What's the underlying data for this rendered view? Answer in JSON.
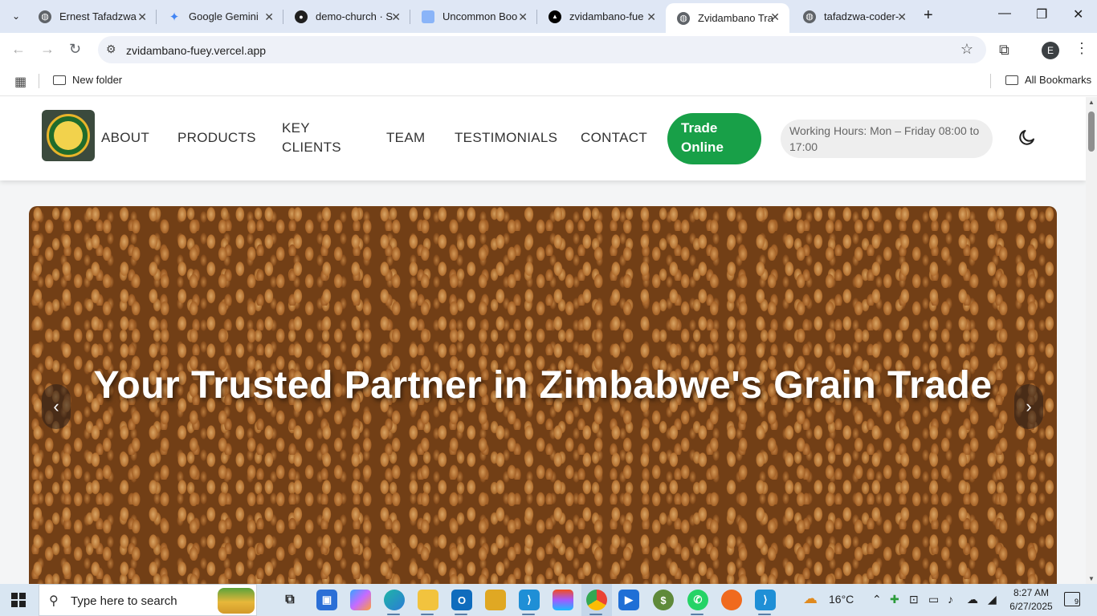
{
  "browser": {
    "tabs": [
      {
        "label": "Ernest Tafadzwa",
        "icon": "globe-icon",
        "color": "#5f6368"
      },
      {
        "label": "Google Gemini",
        "icon": "gemini-icon",
        "color": "#4285f4"
      },
      {
        "label": "demo-church · S",
        "icon": "github-icon",
        "color": "#1f1f1f"
      },
      {
        "label": "Uncommon Boo",
        "icon": "sheets-icon",
        "color": "#8ab4f8"
      },
      {
        "label": "zvidambano-fue",
        "icon": "vercel-icon",
        "color": "#000000"
      },
      {
        "label": "Zvidambano Tra",
        "icon": "globe-icon",
        "color": "#5f6368",
        "active": true
      },
      {
        "label": "tafadzwa-coder-",
        "icon": "globe-icon",
        "color": "#5f6368"
      }
    ],
    "url": "zvidambano-fuey.vercel.app",
    "profile_initial": "E",
    "bookmarks": {
      "folder": "New folder",
      "all": "All Bookmarks"
    }
  },
  "site": {
    "logo_alt": "Zvidambano Traders Pvt Ltd",
    "nav": {
      "about": "ABOUT",
      "products": "PRODUCTS",
      "key_clients_1": "KEY",
      "key_clients_2": "CLIENTS",
      "team": "TEAM",
      "testimonials": "TESTIMONIALS",
      "contact": "CONTACT"
    },
    "trade_button_1": "Trade",
    "trade_button_2": "Online",
    "working_hours": "Working Hours: Mon – Friday 08:00 to 17:00",
    "hero": {
      "title": "Your Trusted Partner in Zimbabwe's Grain Trade",
      "prev": "‹",
      "next": "›"
    },
    "colors": {
      "accent": "#18a048",
      "hours_bg": "#eeeeee"
    }
  },
  "taskbar": {
    "search_placeholder": "Type here to search",
    "weather": "16°C",
    "time": "8:27 AM",
    "date": "6/27/2025",
    "notifications": "9"
  }
}
